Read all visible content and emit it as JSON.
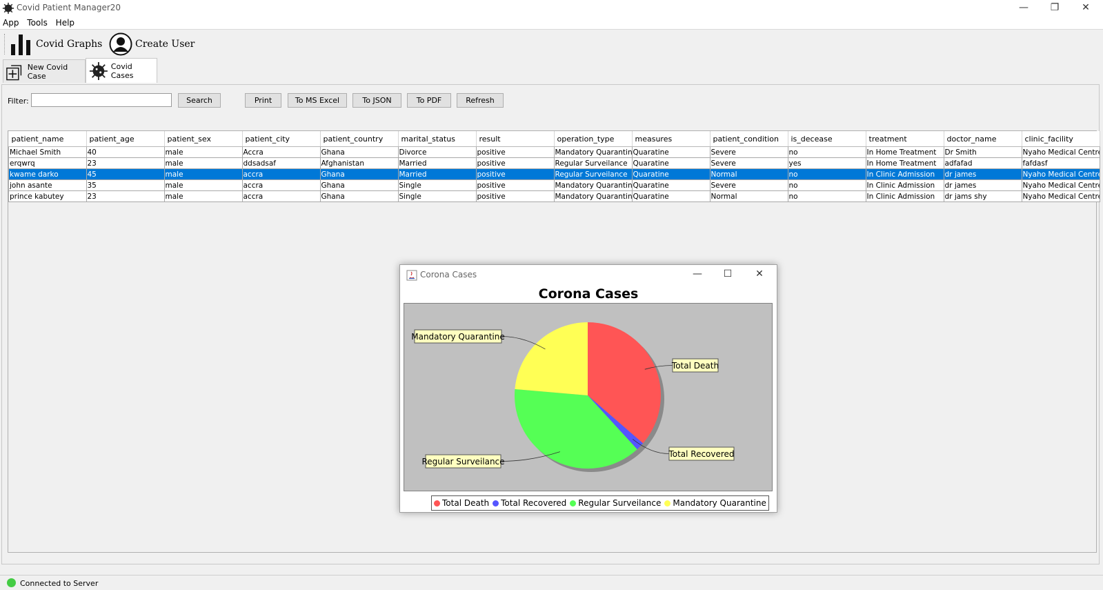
{
  "window": {
    "title": "Covid Patient Manager20",
    "minimize": "—",
    "maximize": "❐",
    "close": "✕"
  },
  "menu": [
    "App",
    "Tools",
    "Help"
  ],
  "toolbar": {
    "graphs_label": "Covid Graphs",
    "create_user_label": "Create User"
  },
  "tabs": [
    {
      "label": "New Covid Case"
    },
    {
      "label": "Covid Cases"
    }
  ],
  "filter": {
    "label": "Filter:",
    "value": ""
  },
  "buttons": {
    "search": "Search",
    "print": "Print",
    "excel": "To MS Excel",
    "json": "To JSON",
    "pdf": "To PDF",
    "refresh": "Refresh"
  },
  "table": {
    "columns": [
      "patient_name",
      "patient_age",
      "patient_sex",
      "patient_city",
      "patient_country",
      "marital_status",
      "result",
      "operation_type",
      "measures",
      "patient_condition",
      "is_decease",
      "treatment",
      "doctor_name",
      "clinic_facility"
    ],
    "selected_row": 2,
    "rows": [
      [
        "Michael Smith",
        "40",
        "male",
        "Accra",
        "Ghana",
        "Divorce",
        "positive",
        "Mandatory Quarantine",
        "Quaratine",
        "Severe",
        "no",
        "In Home Treatment",
        "Dr Smith",
        "Nyaho Medical Centre"
      ],
      [
        "erqwrq",
        "23",
        "male",
        "ddsadsaf",
        "Afghanistan",
        "Married",
        "positive",
        "Regular Surveilance",
        "Quaratine",
        "Severe",
        "yes",
        "In Home Treatment",
        "adfafad",
        "fafdasf"
      ],
      [
        "kwame darko",
        "45",
        "male",
        "accra",
        "Ghana",
        "Married",
        "positive",
        "Regular Surveilance",
        "Quaratine",
        "Normal",
        "no",
        "In Clinic Admission",
        "dr james",
        "Nyaho Medical Centre"
      ],
      [
        "john asante",
        "35",
        "male",
        "accra",
        "Ghana",
        "Single",
        "positive",
        "Mandatory Quarantine",
        "Quaratine",
        "Severe",
        "no",
        "In Clinic Admission",
        "dr james",
        "Nyaho Medical Centre"
      ],
      [
        "prince kabutey",
        "23",
        "male",
        "accra",
        "Ghana",
        "Single",
        "positive",
        "Mandatory Quarantine",
        "Quaratine",
        "Normal",
        "no",
        "In Clinic Admission",
        "dr jams shy",
        "Nyaho Medical Centre"
      ]
    ]
  },
  "chart_window": {
    "title": "Corona Cases",
    "minimize": "—",
    "maximize": "☐",
    "close": "✕"
  },
  "chart_data": {
    "type": "pie",
    "title": "Corona Cases",
    "slices": [
      {
        "name": "Total Death",
        "value": 1,
        "color": "#ff5555"
      },
      {
        "name": "Total Recovered",
        "value": 0.05,
        "color": "#5555ff"
      },
      {
        "name": "Regular Surveilance",
        "value": 1.05,
        "color": "#55ff55"
      },
      {
        "name": "Mandatory Quarantine",
        "value": 0.65,
        "color": "#ffff55"
      }
    ],
    "legend": "bottom"
  },
  "status": {
    "text": "Connected to Server",
    "color": "#44cc44"
  }
}
